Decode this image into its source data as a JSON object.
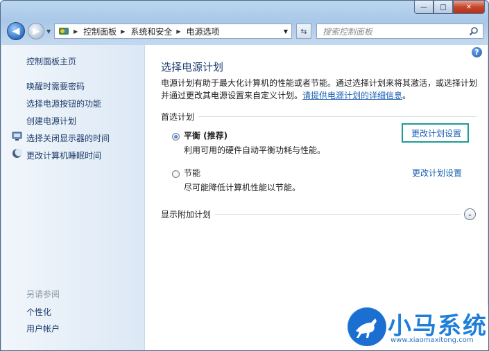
{
  "window": {
    "minimize_glyph": "—",
    "maximize_glyph": "□",
    "close_glyph": "✕"
  },
  "nav": {
    "breadcrumbs": [
      "控制面板",
      "系统和安全",
      "电源选项"
    ],
    "search_placeholder": "搜索控制面板"
  },
  "sidebar": {
    "home": "控制面板主页",
    "links": [
      {
        "label": "唤醒时需要密码",
        "icon": ""
      },
      {
        "label": "选择电源按钮的功能",
        "icon": ""
      },
      {
        "label": "创建电源计划",
        "icon": ""
      },
      {
        "label": "选择关闭显示器的时间",
        "icon": "monitor-icon"
      },
      {
        "label": "更改计算机睡眠时间",
        "icon": "moon-icon"
      }
    ],
    "see_also_heading": "另请参阅",
    "see_also": [
      "个性化",
      "用户帐户"
    ]
  },
  "main": {
    "title": "选择电源计划",
    "desc_line1": "电源计划有助于最大化计算机的性能或者节能。通过选择计划来将其激活，或选择计划",
    "desc_line2_prefix": "并通过更改其电源设置来自定义计划。",
    "desc_link": "请提供电源计划的详细信息",
    "desc_suffix": "。",
    "preferred_heading": "首选计划",
    "plans": [
      {
        "name": "平衡 (推荐)",
        "description": "利用可用的硬件自动平衡功耗与性能。",
        "link": "更改计划设置",
        "selected": true
      },
      {
        "name": "节能",
        "description": "尽可能降低计算机性能以节能。",
        "link": "更改计划设置",
        "selected": false
      }
    ],
    "more_plans": "显示附加计划"
  },
  "watermark": {
    "text": "小马系统",
    "url": "www.xiaomaxitong.com"
  },
  "colors": {
    "accent_link": "#1a5fb4",
    "title_blue": "#1e3f73",
    "highlight_border": "#1f9a96"
  }
}
